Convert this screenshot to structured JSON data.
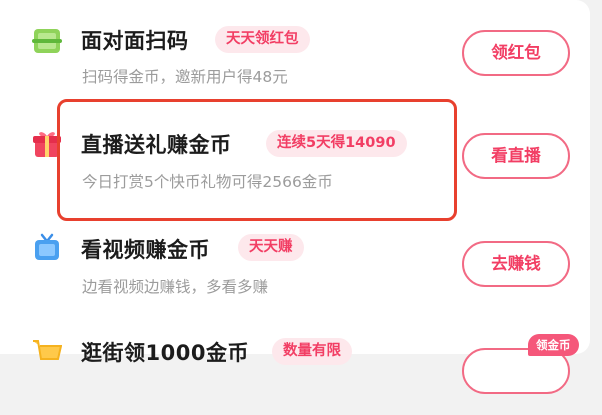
{
  "tasks": [
    {
      "title": "面对面扫码",
      "badge": "天天领红包",
      "subtitle": "扫码得金币，邀新用户得48元",
      "button": "领红包",
      "icon": "scan-qr-icon"
    },
    {
      "title": "直播送礼赚金币",
      "badge": "连续5天得14090",
      "subtitle": "今日打赏5个快币礼物可得2566金币",
      "button": "看直播",
      "icon": "gift-box-icon"
    },
    {
      "title": "看视频赚金币",
      "badge": "天天赚",
      "subtitle": "边看视频边赚钱，多看多赚",
      "button": "去赚钱",
      "icon": "tv-icon"
    },
    {
      "title": "逛街领1000金币",
      "badge": "数量有限",
      "button_badge": "领金币",
      "icon": "shopping-cart-icon"
    }
  ],
  "colors": {
    "accent": "#f23e64",
    "badge_bg": "#fde8ec",
    "highlight_border": "#e8402e"
  }
}
